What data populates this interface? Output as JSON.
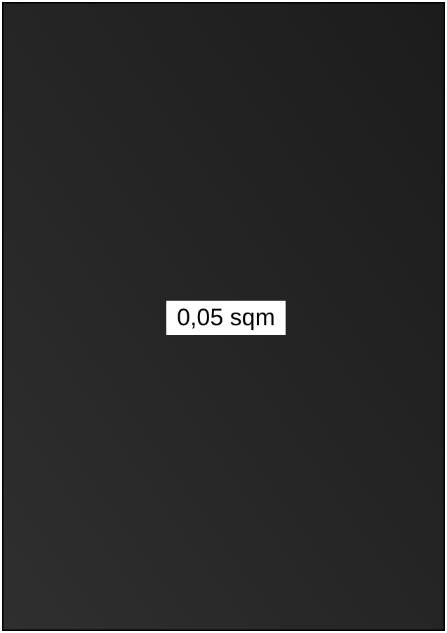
{
  "panel": {
    "fill_gradient": [
      "#2f2f2f",
      "#262626",
      "#1c1c1c"
    ],
    "border_color": "#000000"
  },
  "label": {
    "text": "0,05 sqm",
    "background_color": "#ffffff",
    "text_color": "#000000"
  }
}
